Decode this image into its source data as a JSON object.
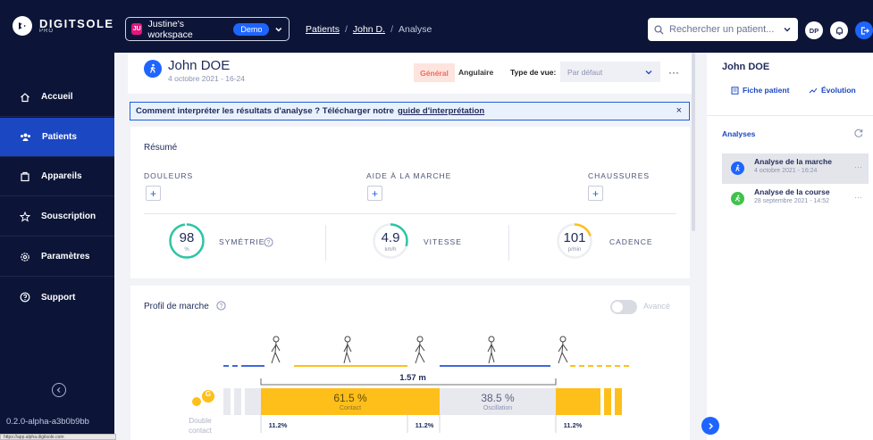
{
  "brand": {
    "name": "DIGITSOLE",
    "sub": "PRO"
  },
  "workspace": {
    "icon": "JU",
    "name": "Justine's workspace",
    "badge": "Demo"
  },
  "breadcrumb": [
    "Patients",
    "/",
    "John D.",
    "/",
    "Analyse"
  ],
  "search": {
    "placeholder": "Rechercher un patient..."
  },
  "user": {
    "initials": "DP"
  },
  "nav": [
    {
      "label": "Accueil",
      "icon": "home-icon",
      "active": true
    },
    {
      "label": "Patients",
      "icon": "patients-icon",
      "active": true
    },
    {
      "label": "Appareils",
      "icon": "devices-icon",
      "active": false
    },
    {
      "label": "Souscription",
      "icon": "subscription-icon",
      "active": false
    },
    {
      "label": "Paramètres",
      "icon": "settings-icon",
      "active": false
    },
    {
      "label": "Support",
      "icon": "support-icon",
      "active": false
    }
  ],
  "version": "0.2.0-alpha-a3b0b9bb",
  "status_url": "https://app.alpha.digitsole.com",
  "patient": {
    "name": "John DOE",
    "date": "4 octobre 2021 - 16-24"
  },
  "view_tabs": {
    "general": "Général",
    "angular": "Angulaire"
  },
  "view_type": {
    "label": "Type de vue:",
    "value": "Par défaut"
  },
  "info_banner": {
    "text": "Comment interpréter les résultats d'analyse ? Télécharger notre",
    "link": "guide d'interprétation",
    "close": "×"
  },
  "summary": {
    "title": "Résumé",
    "categories": [
      "DOULEURS",
      "AIDE À LA MARCHE",
      "CHAUSSURES"
    ],
    "metrics": [
      {
        "value": "98",
        "unit": "%",
        "label": "SYMÉTRIE",
        "fraction": 0.98,
        "color": "#2ec4a5"
      },
      {
        "value": "4.9",
        "unit": "km/h",
        "label": "VITESSE",
        "fraction": 0.3,
        "color": "#2ec4a5"
      },
      {
        "value": "101",
        "unit": "p/min",
        "label": "CADENCE",
        "fraction": 0.2,
        "color": "#ffbf1a"
      }
    ]
  },
  "profile": {
    "title": "Profil de marche",
    "toggle_label": "Avancé",
    "stride_length": "1.57 m",
    "contact": {
      "value": "61.5 %",
      "label": "Contact"
    },
    "oscillation": {
      "value": "38.5 %",
      "label": "Oscillation"
    },
    "double_contact": {
      "label": "Double contact",
      "values": [
        "11.2%",
        "11.2%",
        "11.2%"
      ]
    },
    "foot_badge": "G"
  },
  "right_panel": {
    "name": "John DOE",
    "buttons": [
      "Fiche patient",
      "Évolution"
    ],
    "analyses_title": "Analyses",
    "analyses": [
      {
        "title": "Analyse de la marche",
        "date": "4 octobre 2021 - 16:24",
        "color": "#1e64ff",
        "selected": true
      },
      {
        "title": "Analyse de la course",
        "date": "28 septembre 2021 - 14:52",
        "color": "#3fc24a",
        "selected": false
      }
    ]
  },
  "colors": {
    "navy": "#0c1538",
    "accent": "#1e64ff",
    "active_nav": "#1c47c2",
    "yellow": "#ffbf1a",
    "teal": "#2ec4a5"
  }
}
